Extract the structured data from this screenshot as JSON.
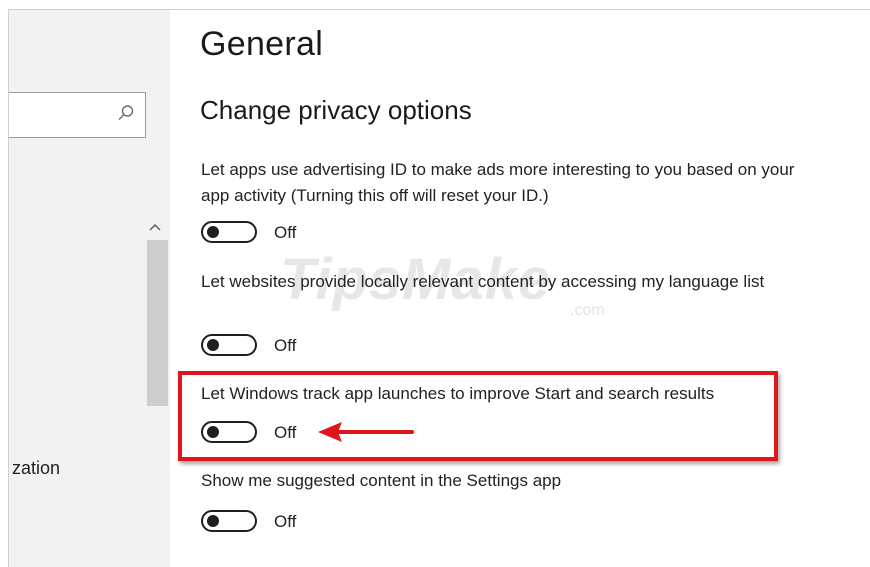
{
  "sidebar": {
    "search": {
      "placeholder": ""
    },
    "nav_item_partial": "zation"
  },
  "page": {
    "title": "General",
    "section_title": "Change privacy options"
  },
  "settings": [
    {
      "label": "Let apps use advertising ID to make ads more interesting to you based on your app activity (Turning this off will reset your ID.)",
      "state": "Off"
    },
    {
      "label": "Let websites provide locally relevant content by accessing my language list",
      "state": "Off"
    },
    {
      "label": "Let Windows track app launches to improve Start and search results",
      "state": "Off"
    },
    {
      "label": "Show me suggested content in the Settings app",
      "state": "Off"
    }
  ],
  "annotation": {
    "highlight_color": "#e0141b"
  },
  "watermark": {
    "text": "TipsMake",
    "suffix": ".com"
  }
}
